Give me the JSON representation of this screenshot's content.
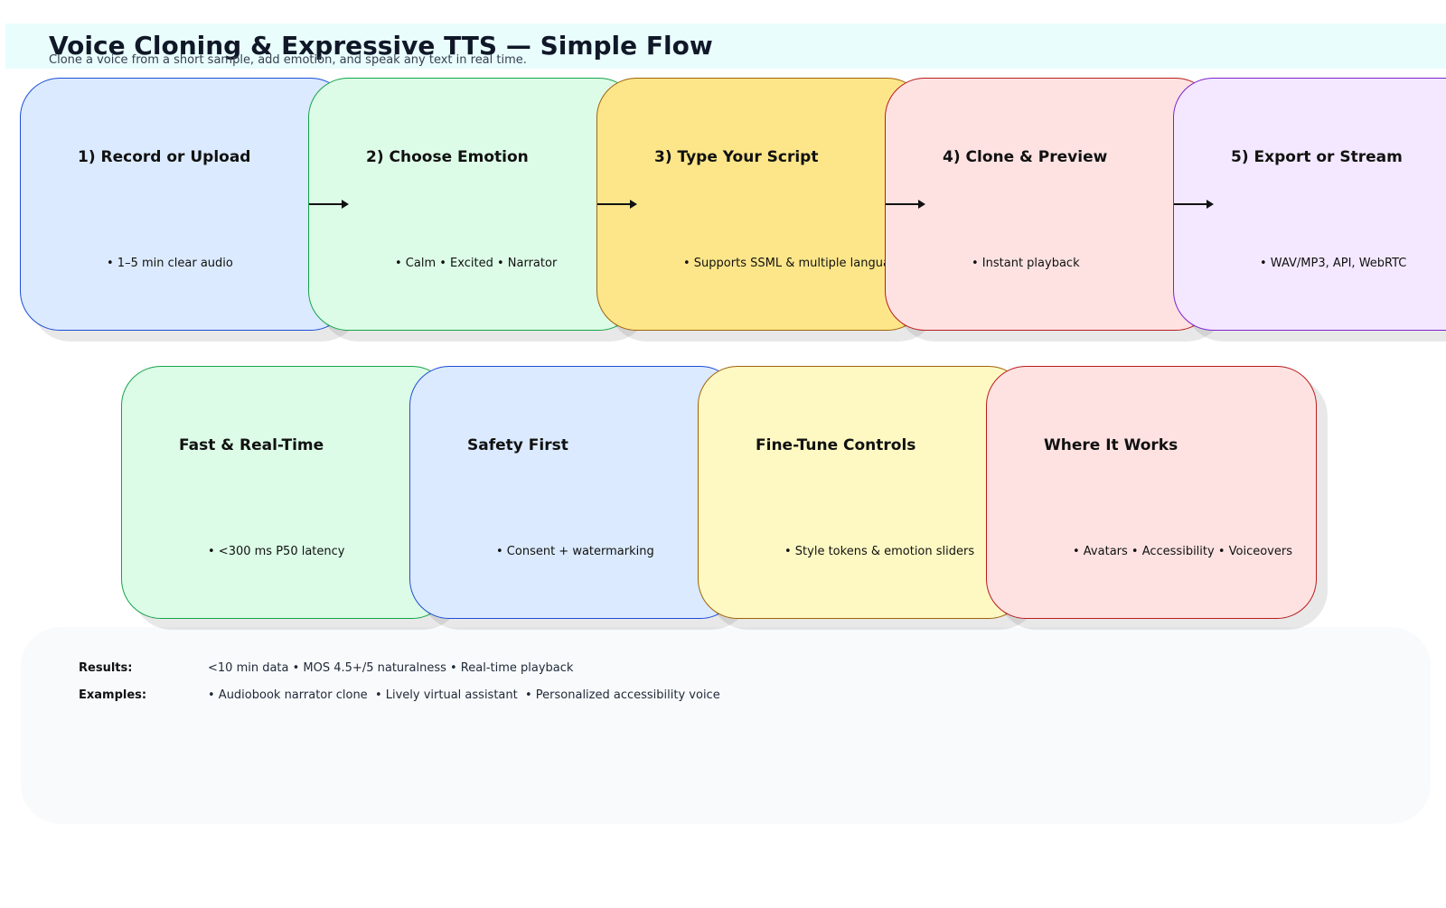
{
  "header": {
    "title": "Voice Cloning & Expressive TTS — Simple Flow",
    "subtitle": "Clone a voice from a short sample, add emotion, and speak any text in real time."
  },
  "steps": [
    {
      "title": "1) Record or Upload",
      "bullet": "• 1–5 min clear audio"
    },
    {
      "title": "2) Choose Emotion",
      "bullet": "• Calm • Excited • Narrator"
    },
    {
      "title": "3) Type Your Script",
      "bullet": "• Supports SSML & multiple languages"
    },
    {
      "title": "4) Clone & Preview",
      "bullet": "• Instant playback"
    },
    {
      "title": "5) Export or Stream",
      "bullet": "• WAV/MP3, API, WebRTC"
    }
  ],
  "features": [
    {
      "title": "Fast & Real-Time",
      "bullet": "• <300 ms P50 latency"
    },
    {
      "title": "Safety First",
      "bullet": "• Consent + watermarking"
    },
    {
      "title": "Fine-Tune Controls",
      "bullet": "• Style tokens & emotion sliders"
    },
    {
      "title": "Where It Works",
      "bullet": "• Avatars • Accessibility • Voiceovers"
    }
  ],
  "results": {
    "results_label": "Results:",
    "results_text": "<10 min data • MOS 4.5+/5 naturalness • Real-time playback",
    "examples_label": "Examples:",
    "examples_text": "• Audiobook narrator clone  • Lively virtual assistant  • Personalized accessibility voice"
  },
  "colors": {
    "blue_fill": "#dbeafe",
    "blue_border": "#1d4ed8",
    "green_fill": "#dcfce7",
    "green_border": "#16a34a",
    "amber_fill": "#fde68a",
    "amber_border": "#a16207",
    "yellow_fill": "#fef9c3",
    "yellow_border": "#a16207",
    "red_fill": "#fee2e2",
    "red_border": "#b91c1c",
    "purple_fill": "#f3e8ff",
    "purple_border": "#7e22ce",
    "header_band": "#e9fdfd",
    "panel": "#f8fafc"
  }
}
